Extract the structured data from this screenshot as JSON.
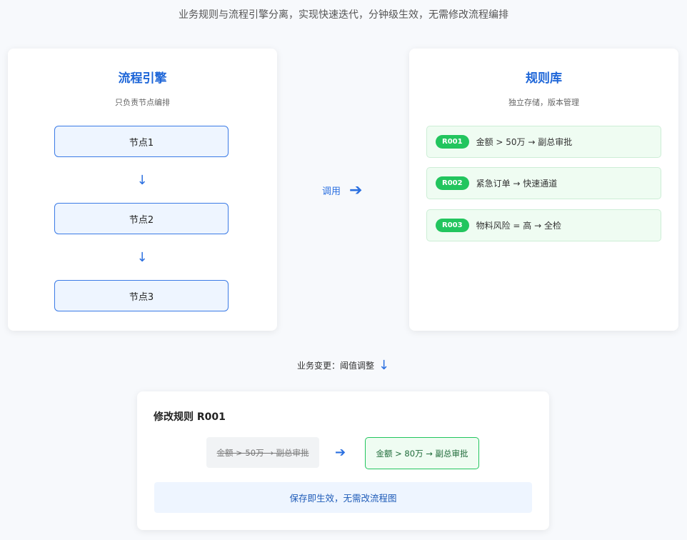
{
  "subtitle": "业务规则与流程引擎分离，实现快速迭代，分钟级生效，无需修改流程编排",
  "engine": {
    "title": "流程引擎",
    "sub": "只负责节点编排",
    "nodes": [
      "节点1",
      "节点2",
      "节点3"
    ],
    "arrow": "↓"
  },
  "call": {
    "label": "调用",
    "arrow": "➔"
  },
  "library": {
    "title": "规则库",
    "sub": "独立存储，版本管理",
    "rules": [
      {
        "id": "R001",
        "text": "金额 > 50万 → 副总审批"
      },
      {
        "id": "R002",
        "text": "紧急订单 → 快速通道"
      },
      {
        "id": "R003",
        "text": "物料风险 = 高 → 全检"
      }
    ]
  },
  "change": {
    "label": "业务变更：阈值调整",
    "arrow": "↓"
  },
  "edit": {
    "title": "修改规则 R001",
    "old_rule": "金额 > 50万 → 副总审批",
    "arrow": "➔",
    "new_rule": "金额 > 80万 → 副总审批",
    "note": "保存即生效，无需改流程图"
  },
  "colors": {
    "accent": "#1e66d8",
    "green": "#22c55e"
  }
}
